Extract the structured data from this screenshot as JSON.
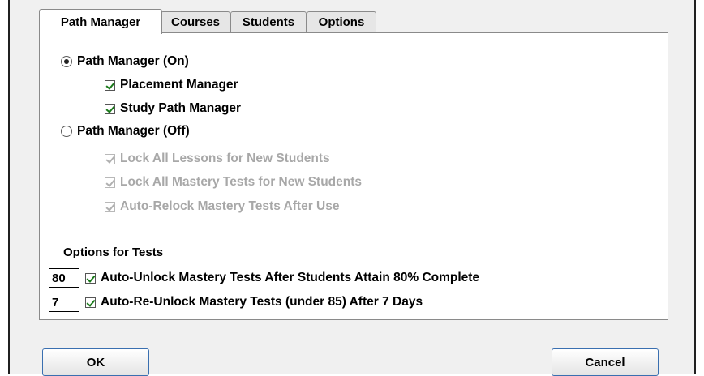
{
  "tabs": [
    {
      "label": "Path Manager",
      "active": true
    },
    {
      "label": "Courses",
      "active": false
    },
    {
      "label": "Students",
      "active": false
    },
    {
      "label": "Options",
      "active": false
    }
  ],
  "path_manager_on": {
    "label": "Path Manager (On)",
    "selected": true
  },
  "placement_manager": {
    "label": "Placement Manager",
    "checked": true
  },
  "study_path_manager": {
    "label": "Study Path Manager",
    "checked": true
  },
  "path_manager_off": {
    "label": "Path Manager (Off)",
    "selected": false
  },
  "lock_lessons": {
    "label": "Lock All Lessons for New Students",
    "checked": true,
    "enabled": false
  },
  "lock_mastery": {
    "label": "Lock All Mastery Tests for New Students",
    "checked": true,
    "enabled": false
  },
  "auto_relock": {
    "label": "Auto-Relock Mastery Tests After Use",
    "checked": true,
    "enabled": false
  },
  "options_for_tests": {
    "label": "Options for Tests"
  },
  "auto_unlock": {
    "value": "80",
    "label": "Auto-Unlock Mastery Tests After Students Attain 80% Complete",
    "checked": true
  },
  "auto_reunlock": {
    "value": "7",
    "label": "Auto-Re-Unlock Mastery Tests (under 85) After 7 Days",
    "checked": true
  },
  "buttons": {
    "ok": "OK",
    "cancel": "Cancel"
  }
}
